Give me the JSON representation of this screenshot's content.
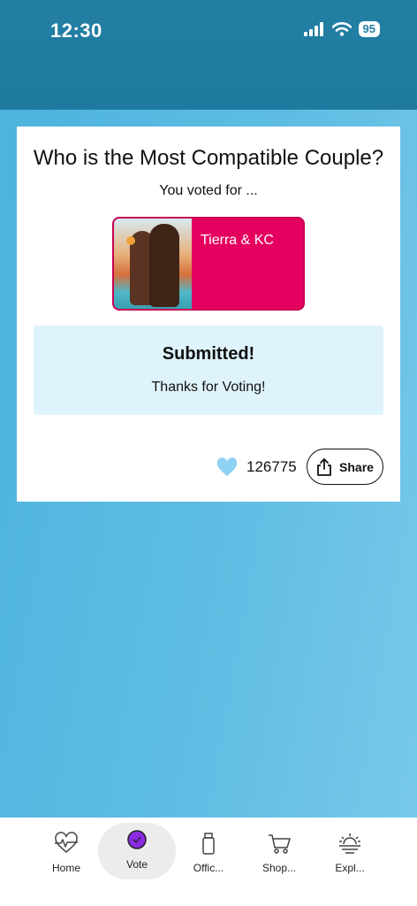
{
  "status_bar": {
    "time": "12:30",
    "battery": "95"
  },
  "poll": {
    "question": "Who is the Most Compatible Couple?",
    "voted_for_label": "You voted for ...",
    "choice_name": "Tierra & KC",
    "submitted_title": "Submitted!",
    "submitted_subtitle": "Thanks for Voting!",
    "like_count": "126775",
    "share_label": "Share"
  },
  "tabs": [
    {
      "label": "Home",
      "icon": "heartbeat-icon"
    },
    {
      "label": "Vote",
      "icon": "vote-check-icon"
    },
    {
      "label": "Offic...",
      "icon": "bottle-icon"
    },
    {
      "label": "Shop...",
      "icon": "cart-icon"
    },
    {
      "label": "Expl...",
      "icon": "sunset-icon"
    }
  ],
  "colors": {
    "header": "#237fa3",
    "accent_pink": "#e5005f",
    "submitted_bg": "#def3fb",
    "heart": "#8fd3f4",
    "vote_purple": "#8a2be2"
  }
}
